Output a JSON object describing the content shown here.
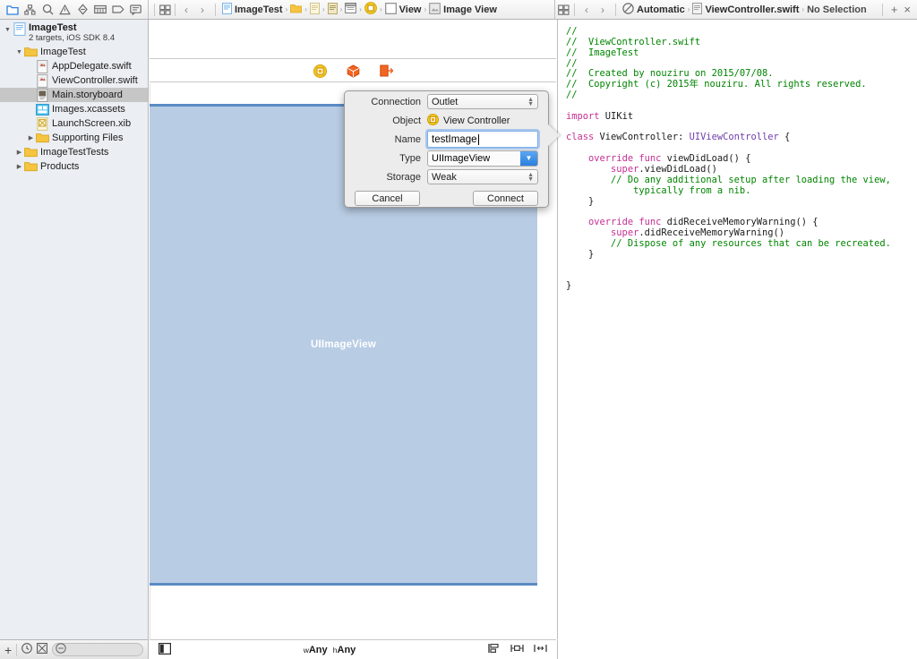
{
  "toolbar": {
    "navigator_tabs": [
      {
        "name": "project-navigator",
        "icon": "folder-icon",
        "active": true
      },
      {
        "name": "symbol-navigator",
        "icon": "hierarchy-icon",
        "active": false
      },
      {
        "name": "find-navigator",
        "icon": "search-icon",
        "active": false
      },
      {
        "name": "issue-navigator",
        "icon": "warning-triangle-icon",
        "active": false
      },
      {
        "name": "test-navigator",
        "icon": "no-entry-icon",
        "active": false
      },
      {
        "name": "debug-navigator",
        "icon": "list-icon",
        "active": false
      },
      {
        "name": "breakpoint-navigator",
        "icon": "tag-icon",
        "active": false
      },
      {
        "name": "report-navigator",
        "icon": "speech-bubble-icon",
        "active": false
      }
    ],
    "assistant_icon": "assistant-editor-icon",
    "back_arrow": "‹",
    "forward_arrow": "›"
  },
  "left_breadcrumb": {
    "items": [
      {
        "label": "ImageTest",
        "icon": "project-file-icon"
      },
      {
        "label": "",
        "icon": "folder-icon"
      },
      {
        "label": "",
        "icon": "swift-file-icon"
      },
      {
        "label": "",
        "icon": "document-icon"
      },
      {
        "label": "",
        "icon": "storyboard-icon"
      },
      {
        "label": "",
        "icon": "view-controller-icon"
      },
      {
        "label": "View",
        "icon": "view-icon"
      },
      {
        "label": "Image View",
        "icon": "image-view-icon"
      }
    ],
    "separator": "›"
  },
  "right_breadcrumb": {
    "items": [
      {
        "label": "Automatic",
        "icon": "automatic-icon"
      },
      {
        "label": "ViewController.swift",
        "icon": "swift-file-icon"
      },
      {
        "label": "No Selection",
        "icon": ""
      }
    ],
    "separator": "›",
    "add_label": "+",
    "close_label": "×"
  },
  "navigator": {
    "tree": [
      {
        "label": "ImageTest",
        "sublabel": "2 targets, iOS SDK 8.4",
        "icon": "project-file-icon",
        "depth": 0,
        "twisty": "down",
        "selected": false,
        "bold": true
      },
      {
        "label": "ImageTest",
        "sublabel": "",
        "icon": "folder-icon",
        "depth": 1,
        "twisty": "down",
        "selected": false,
        "bold": false
      },
      {
        "label": "AppDelegate.swift",
        "sublabel": "",
        "icon": "swift-file-icon",
        "depth": 2,
        "twisty": "none",
        "selected": false,
        "bold": false
      },
      {
        "label": "ViewController.swift",
        "sublabel": "",
        "icon": "swift-file-icon",
        "depth": 2,
        "twisty": "none",
        "selected": false,
        "bold": false
      },
      {
        "label": "Main.storyboard",
        "sublabel": "",
        "icon": "storyboard-file-icon",
        "depth": 2,
        "twisty": "none",
        "selected": true,
        "bold": false
      },
      {
        "label": "Images.xcassets",
        "sublabel": "",
        "icon": "xcassets-icon",
        "depth": 2,
        "twisty": "none",
        "selected": false,
        "bold": false
      },
      {
        "label": "LaunchScreen.xib",
        "sublabel": "",
        "icon": "xib-file-icon",
        "depth": 2,
        "twisty": "none",
        "selected": false,
        "bold": false
      },
      {
        "label": "Supporting Files",
        "sublabel": "",
        "icon": "folder-icon",
        "depth": 2,
        "twisty": "right",
        "selected": false,
        "bold": false
      },
      {
        "label": "ImageTestTests",
        "sublabel": "",
        "icon": "folder-icon",
        "depth": 1,
        "twisty": "right",
        "selected": false,
        "bold": false
      },
      {
        "label": "Products",
        "sublabel": "",
        "icon": "folder-icon",
        "depth": 1,
        "twisty": "right",
        "selected": false,
        "bold": false
      }
    ],
    "bottom_bar": {
      "add_label": "+",
      "recent_icon": "clock-icon",
      "source_control_icon": "filter-source-icon",
      "filter_placeholder": "",
      "filter_value": "",
      "filter_icon": "filter-round-icon"
    }
  },
  "storyboard": {
    "scene_dock": [
      {
        "name": "view-controller-dock-icon"
      },
      {
        "name": "first-responder-dock-icon"
      },
      {
        "name": "exit-dock-icon"
      }
    ],
    "image_view_label": "UIImageView",
    "canvas_color": "#b8cce4",
    "selection_color": "#5a8bc4",
    "bottom_bar": {
      "outline_toggle_icon": "document-outline-icon",
      "size_class_w_prefix": "w",
      "size_class_w": "Any",
      "size_class_h_prefix": "h",
      "size_class_h": "Any",
      "align_icon": "align-icon",
      "pin_icon": "pin-icon",
      "resolve_icon": "resolve-issues-icon"
    }
  },
  "popover": {
    "rows": {
      "connection_label": "Connection",
      "connection_value": "Outlet",
      "object_label": "Object",
      "object_value": "View Controller",
      "object_icon": "view-controller-icon",
      "name_label": "Name",
      "name_value": "testImage",
      "type_label": "Type",
      "type_value": "UIImageView",
      "storage_label": "Storage",
      "storage_value": "Weak"
    },
    "cancel_label": "Cancel",
    "connect_label": "Connect",
    "accent_color": "#2b7fe0"
  },
  "editor": {
    "code_lines": [
      [
        {
          "t": "//",
          "c": "cm"
        }
      ],
      [
        {
          "t": "//  ViewController.swift",
          "c": "cm"
        }
      ],
      [
        {
          "t": "//  ImageTest",
          "c": "cm"
        }
      ],
      [
        {
          "t": "//",
          "c": "cm"
        }
      ],
      [
        {
          "t": "//  Created by nouziru on 2015/07/08.",
          "c": "cm"
        }
      ],
      [
        {
          "t": "//  Copyright (c) 2015年 nouziru. All rights reserved.",
          "c": "cm"
        }
      ],
      [
        {
          "t": "//",
          "c": "cm"
        }
      ],
      [
        {
          "t": "",
          "c": "fn"
        }
      ],
      [
        {
          "t": "import",
          "c": "kw"
        },
        {
          "t": " UIKit",
          "c": "fn"
        }
      ],
      [
        {
          "t": "",
          "c": "fn"
        }
      ],
      [
        {
          "t": "class",
          "c": "kw"
        },
        {
          "t": " ViewController: ",
          "c": "fn"
        },
        {
          "t": "UIViewController",
          "c": "ty"
        },
        {
          "t": " {",
          "c": "fn"
        }
      ],
      [
        {
          "t": "",
          "c": "fn"
        }
      ],
      [
        {
          "t": "    ",
          "c": "fn"
        },
        {
          "t": "override func",
          "c": "kw"
        },
        {
          "t": " viewDidLoad() {",
          "c": "fn"
        }
      ],
      [
        {
          "t": "        ",
          "c": "fn"
        },
        {
          "t": "super",
          "c": "kw"
        },
        {
          "t": ".viewDidLoad()",
          "c": "fn"
        }
      ],
      [
        {
          "t": "        ",
          "c": "fn"
        },
        {
          "t": "// Do any additional setup after loading the view,",
          "c": "cm"
        }
      ],
      [
        {
          "t": "            ",
          "c": "fn"
        },
        {
          "t": "typically from a nib.",
          "c": "cm"
        }
      ],
      [
        {
          "t": "    }",
          "c": "fn"
        }
      ],
      [
        {
          "t": "",
          "c": "fn"
        }
      ],
      [
        {
          "t": "    ",
          "c": "fn"
        },
        {
          "t": "override func",
          "c": "kw"
        },
        {
          "t": " didReceiveMemoryWarning() {",
          "c": "fn"
        }
      ],
      [
        {
          "t": "        ",
          "c": "fn"
        },
        {
          "t": "super",
          "c": "kw"
        },
        {
          "t": ".didReceiveMemoryWarning()",
          "c": "fn"
        }
      ],
      [
        {
          "t": "        ",
          "c": "fn"
        },
        {
          "t": "// Dispose of any resources that can be recreated.",
          "c": "cm"
        }
      ],
      [
        {
          "t": "    }",
          "c": "fn"
        }
      ],
      [
        {
          "t": "",
          "c": "fn"
        }
      ],
      [
        {
          "t": "",
          "c": "fn"
        }
      ],
      [
        {
          "t": "}",
          "c": "fn"
        }
      ]
    ]
  }
}
